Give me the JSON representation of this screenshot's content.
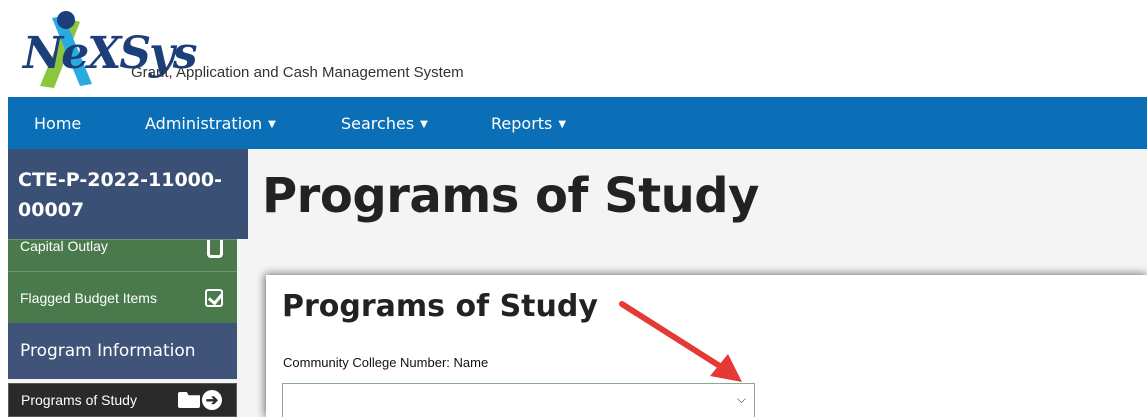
{
  "header": {
    "logo_text": "NeXSys",
    "tagline": "Grant, Application and Cash Management System"
  },
  "nav": {
    "items": [
      {
        "label": "Home",
        "has_caret": false
      },
      {
        "label": "Administration",
        "has_caret": true
      },
      {
        "label": "Searches",
        "has_caret": true
      },
      {
        "label": "Reports",
        "has_caret": true
      }
    ]
  },
  "sidebar": {
    "grant_id_line1": "CTE-P-2022-11000-",
    "grant_id_line2": "00007",
    "items": [
      {
        "label": "Capital Outlay",
        "icon": "clipboard-icon"
      },
      {
        "label": "Flagged Budget Items",
        "icon": "checkbox-icon"
      },
      {
        "label": "Program Information"
      },
      {
        "label": "Programs of Study",
        "icon": "folder-arrow-icon"
      }
    ]
  },
  "main": {
    "page_title": "Programs of Study",
    "card_title": "Programs of Study",
    "field_label": "Community College Number: Name",
    "select_value": ""
  },
  "colors": {
    "nav_bg": "#0b6fb8",
    "sidebar_header": "#3b5075",
    "sidebar_green": "#4a7a4c",
    "annotation_arrow": "#e53935"
  }
}
